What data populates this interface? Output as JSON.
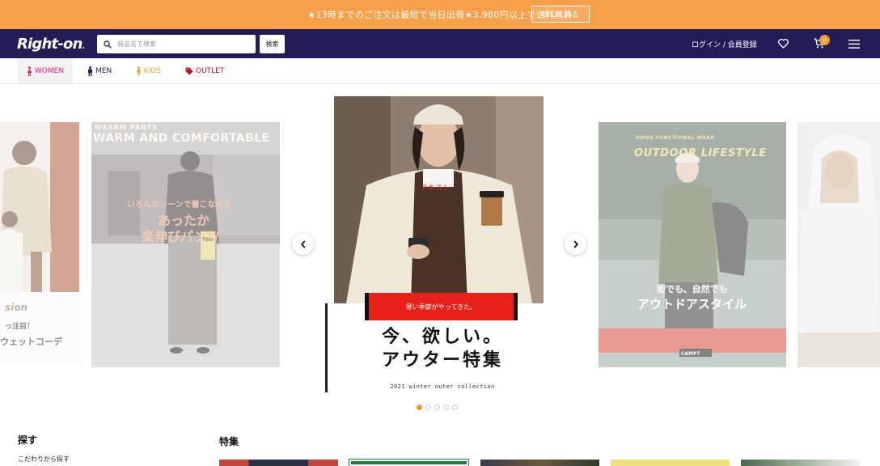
{
  "promo": {
    "text": "★13時までのご注文は最短で当日出荷★3,980円以上で送料無料",
    "button_label": "詳しく見る"
  },
  "header": {
    "logo": "Right-on",
    "logo_dot": ".",
    "search_placeholder": "商品名で検索",
    "search_button": "検索",
    "login_label": "ログイン / 会員登録",
    "cart_count": "0"
  },
  "categories": [
    {
      "label": "WOMEN",
      "icon": "woman-icon",
      "color": "#e2236e"
    },
    {
      "label": "MEN",
      "icon": "man-icon",
      "color": "#231c56"
    },
    {
      "label": "KIDS",
      "icon": "child-icon",
      "color": "#f0a232"
    },
    {
      "label": "OUTLET",
      "icon": "tag-icon",
      "color": "#b3102a"
    }
  ],
  "carousel": {
    "center": {
      "overlay_label": "テキスト",
      "band_text": "寒い季節がやってきた。",
      "title_line1": "今、欲しい。",
      "title_line2": "アウター特集",
      "subtitle": "2021 winter outer collection"
    },
    "left1": {
      "header_small": "WAARM PANTS",
      "header_big": "WARM AND COMFORTABLE",
      "line1": "いろんなシーンで着こなせる",
      "line2": "あったか",
      "line3": "楽伸びパンツ",
      "bag_text": "TBG"
    },
    "left2": {
      "line1": "sion",
      "line2": "っ注目！",
      "line3": "ウェットコーデ"
    },
    "right1": {
      "header_small": "GOOD FUNCTIONAL WEAR",
      "header_big": "OUTDOOR LIFESTYLE",
      "line1": "街でも、自然でも",
      "line2": "アウトドアスタイル",
      "brand": "CAMP7"
    },
    "dots": 5,
    "active_dot": 0
  },
  "sections": {
    "search_title": "探す",
    "search_sub": "こだわりから探す",
    "feature_title": "特集"
  },
  "colors": {
    "promo": "#f6a04a",
    "header": "#231c56",
    "accent": "#f39a2b",
    "red": "#e8201a"
  }
}
